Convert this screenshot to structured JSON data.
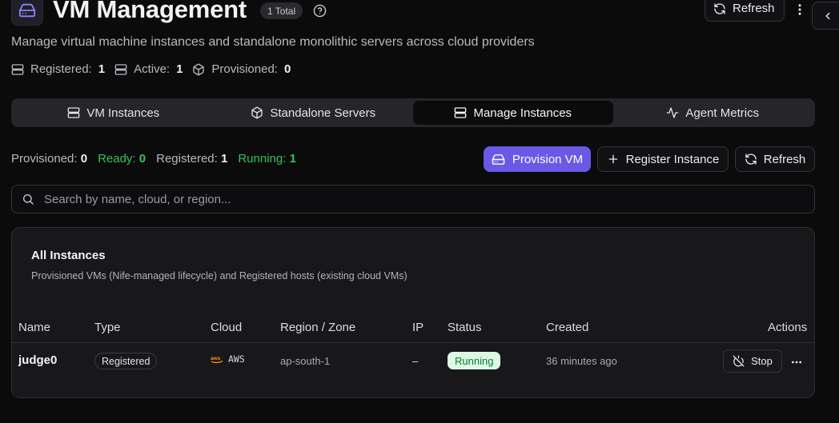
{
  "header": {
    "title": "VM Management",
    "total_badge": "1 Total",
    "refresh_label": "Refresh",
    "subtitle": "Manage virtual machine instances and standalone monolithic servers across cloud providers"
  },
  "stats": [
    {
      "label": "Registered:",
      "value": "1",
      "icon": "server-icon"
    },
    {
      "label": "Active:",
      "value": "1",
      "icon": "server-icon"
    },
    {
      "label": "Provisioned:",
      "value": "0",
      "icon": "box-icon"
    }
  ],
  "tabs": [
    {
      "label": "VM Instances",
      "icon": "server-icon",
      "active": false
    },
    {
      "label": "Standalone Servers",
      "icon": "box-icon",
      "active": false
    },
    {
      "label": "Manage Instances",
      "icon": "server-icon",
      "active": true
    },
    {
      "label": "Agent Metrics",
      "icon": "activity-icon",
      "active": false
    }
  ],
  "counts": {
    "provisioned_label": "Provisioned:",
    "provisioned_value": "0",
    "ready_label": "Ready:",
    "ready_value": "0",
    "registered_label": "Registered:",
    "registered_value": "1",
    "running_label": "Running:",
    "running_value": "1"
  },
  "toolbar": {
    "provision_label": "Provision VM",
    "register_label": "Register Instance",
    "refresh_label": "Refresh"
  },
  "search": {
    "placeholder": "Search by name, cloud, or region..."
  },
  "card": {
    "title": "All Instances",
    "description": "Provisioned VMs (Nife-managed lifecycle) and Registered hosts (existing cloud VMs)"
  },
  "table": {
    "columns": [
      "Name",
      "Type",
      "Cloud",
      "Region / Zone",
      "IP",
      "Status",
      "Created",
      "Actions"
    ],
    "rows": [
      {
        "name": "judge0",
        "type": "Registered",
        "cloud": "AWS",
        "region": "ap-south-1",
        "ip": "–",
        "status": "Running",
        "created": "36 minutes ago",
        "action": "Stop"
      }
    ]
  },
  "colors": {
    "accent": "#6a59e6",
    "success": "#35c25a",
    "status_bg": "#ddf9e6",
    "aws_orange": "#ff9900"
  }
}
